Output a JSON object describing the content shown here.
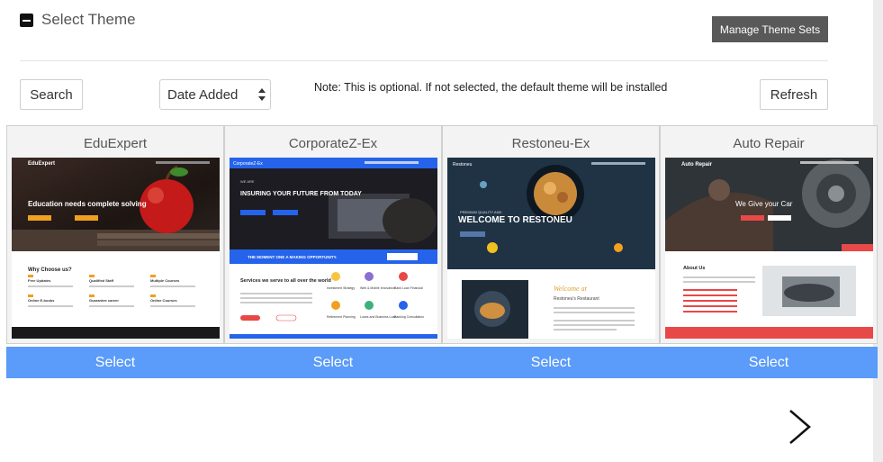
{
  "header": {
    "title": "Select Theme",
    "manage_label": "Manage Theme Sets"
  },
  "toolbar": {
    "search_label": "Search",
    "sort_value": "Date Added",
    "note": "Note: This is optional. If not selected, the default theme will be installed",
    "refresh_label": "Refresh"
  },
  "themes": [
    {
      "name": "EduExpert",
      "select_label": "Select",
      "preview": {
        "brand": "EduExpert",
        "headline": "Education needs complete solving",
        "section": "Why Choose us?",
        "features": [
          "Free Updates",
          "Qualified Staff",
          "Multiple Courses",
          "Online E-books",
          "Guarantee career",
          "Online Courses"
        ]
      }
    },
    {
      "name": "CorporateZ-Ex",
      "select_label": "Select",
      "preview": {
        "brand": "CorporateZ-Ex",
        "headline": "INSURING YOUR FUTURE FROM TODAY",
        "banner": "THE MOMENT ONE A MAKING OPPORTUNITY.",
        "section": "Services we serve to all over the world",
        "services": [
          "Investment Strategy",
          "Web & Mobile Innovation",
          "Bank Loan Financial",
          "Retirement Planning",
          "Loans and Business Loan",
          "Banking Consultation"
        ]
      }
    },
    {
      "name": "Restoneu-Ex",
      "select_label": "Select",
      "preview": {
        "brand": "Restoneu",
        "headline": "WELCOME TO RESTONEU",
        "welcome": "Welcome at",
        "section": "Restoneu's Restaurant"
      }
    },
    {
      "name": "Auto Repair",
      "select_label": "Select",
      "preview": {
        "brand": "Auto Repair",
        "headline": "We Give your Car",
        "section": "About Us"
      }
    }
  ],
  "colors": {
    "select_bar": "#5b9bf9",
    "dark_button": "#595959",
    "corporate_blue": "#2563eb",
    "accent_orange": "#f0a020",
    "auto_red": "#e84848"
  },
  "icons": {
    "collapse": "minus-square-icon",
    "next": "chevron-right-icon",
    "sort": "select-arrows-icon"
  }
}
